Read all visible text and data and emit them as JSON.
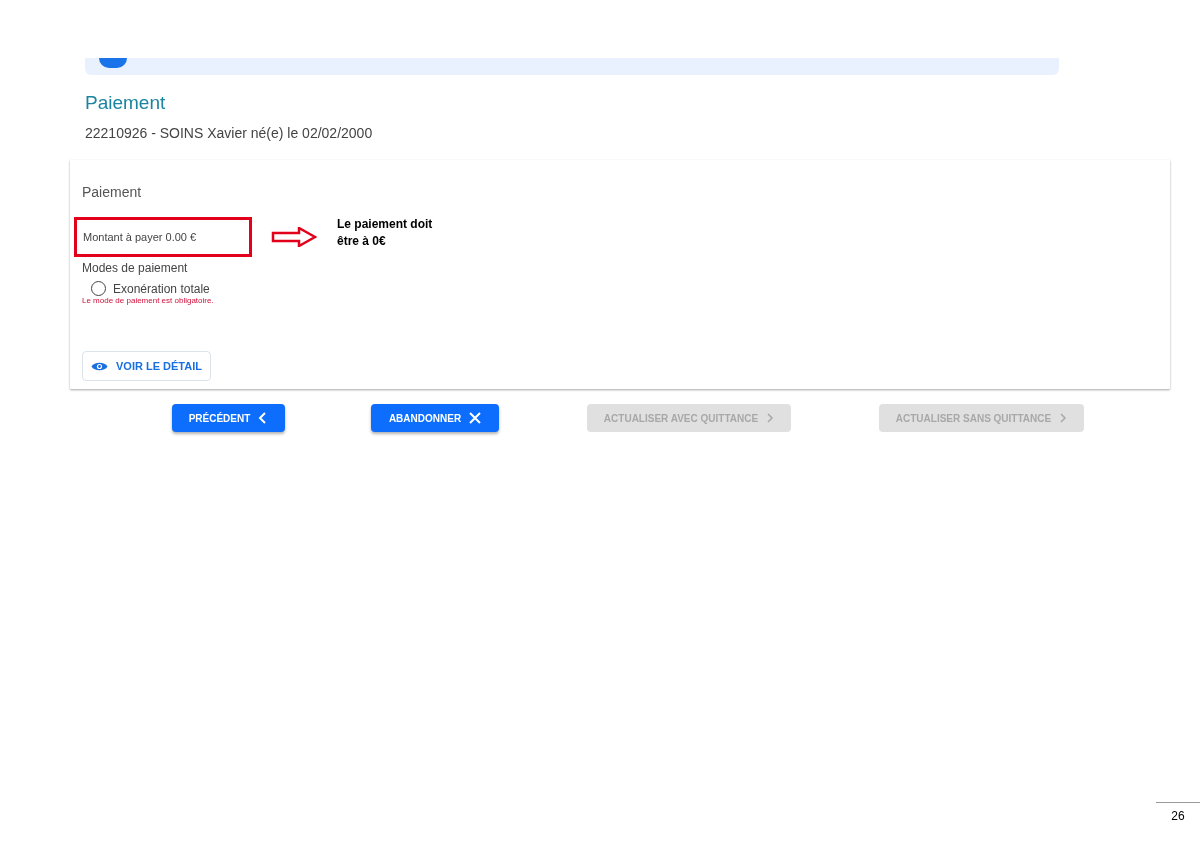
{
  "page": {
    "title": "Paiement",
    "patient": "22210926 - SOINS Xavier né(e) le 02/02/2000"
  },
  "card": {
    "title": "Paiement",
    "amount": "Montant à payer 0.00 €",
    "modes_label": "Modes de paiement",
    "options": [
      {
        "label": "Exonération totale",
        "selected": false
      }
    ],
    "error": "Le mode de paiement est obligatoire.",
    "detail_button": "VOIR LE DÉTAIL"
  },
  "annotation": {
    "note": "Le paiement doit être à 0€"
  },
  "buttons": [
    {
      "label": "PRÉCÉDENT",
      "kind": "back",
      "disabled": false
    },
    {
      "label": "ABANDONNER",
      "kind": "cancel",
      "disabled": false
    },
    {
      "label": "ACTUALISER AVEC QUITTANCE",
      "kind": "next",
      "disabled": true
    },
    {
      "label": "ACTUALISER SANS QUITTANCE",
      "kind": "next",
      "disabled": true
    }
  ],
  "page_number": "26"
}
